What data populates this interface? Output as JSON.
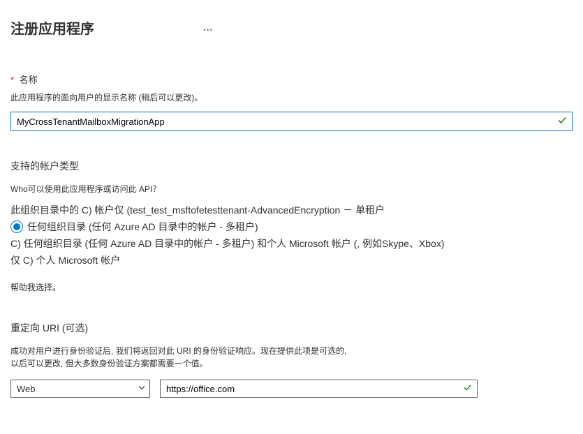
{
  "header": {
    "title": "注册应用程序"
  },
  "name_section": {
    "label": "名称",
    "description": "此应用程序的面向用户的显示名称 (稍后可以更改)。",
    "value": "MyCrossTenantMailboxMigrationApp"
  },
  "account_section": {
    "title": "支持的帐户类型",
    "question": "Who可以使用此应用程序或访问此 API？",
    "options": {
      "opt0": "此组织目录中的 C) 帐户仅 (test_test_msftofetesttenant-AdvancedEncryption － 单租户",
      "opt1": "任何组织目录 (任何 Azure AD 目录中的帐户 - 多租户)",
      "opt2": "C) 任何组织目录 (任何 Azure AD 目录中的帐户 - 多租户) 和个人 Microsoft 帐户 (, 例如Skype、Xbox)",
      "opt3": "仅 C) 个人 Microsoft 帐户"
    },
    "help": "帮助我选择。"
  },
  "redirect_section": {
    "title": "重定向 URI (可选)",
    "description_line1": "成功对用户进行身份验证后, 我们将返回对此 URI 的身份验证响应。现在提供此项是可选的,",
    "description_line2": "以后可以更改, 但大多数身份验证方案都需要一个值。",
    "platform_selected": "Web",
    "uri_value": "https://office.com"
  }
}
